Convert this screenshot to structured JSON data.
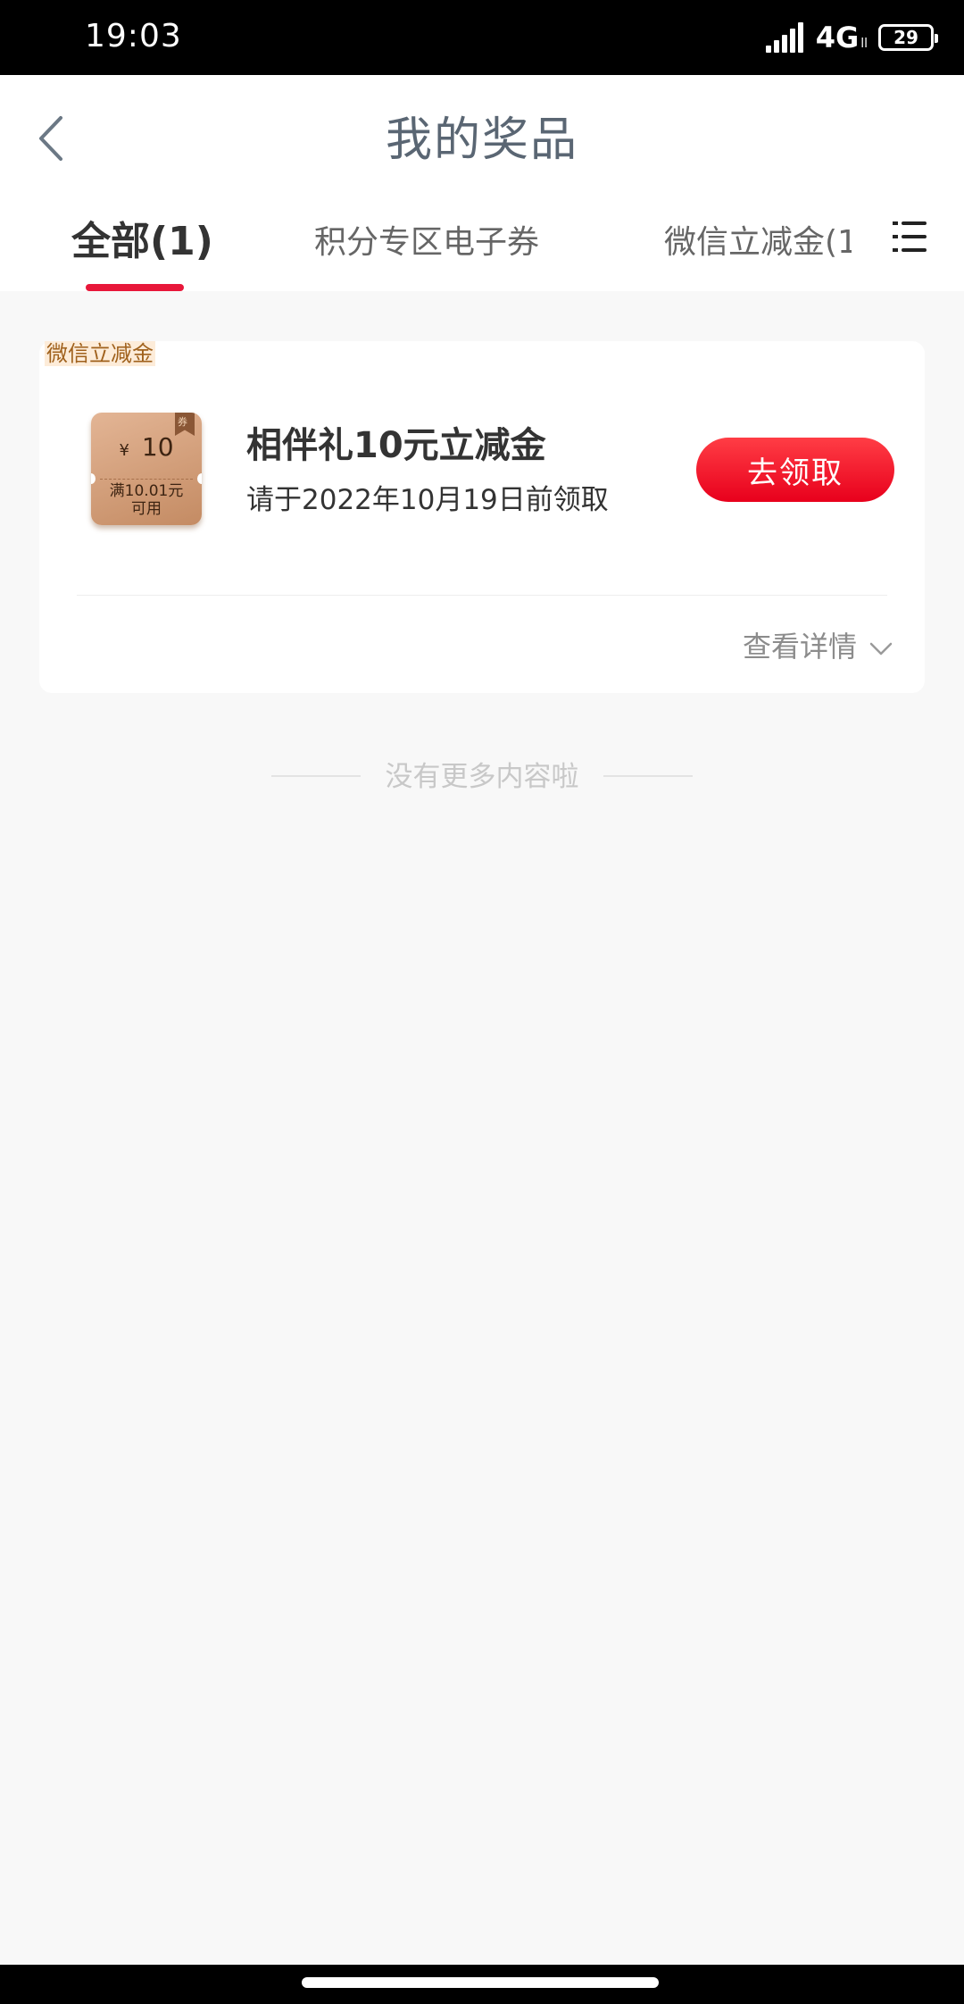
{
  "status_bar": {
    "time": "19:03",
    "network": "4G",
    "network_sub": "ll",
    "battery": "29",
    "icons": [
      "signal-icon",
      "battery-icon"
    ]
  },
  "header": {
    "title": "我的奖品",
    "back_icon": "back-arrow-icon"
  },
  "tabs": {
    "items": [
      {
        "label": "全部(1)",
        "active": true
      },
      {
        "label": "积分专区电子券",
        "active": false
      },
      {
        "label": "微信立减金(1",
        "active": false
      }
    ],
    "menu_icon": "list-menu-icon",
    "accent_color": "#e8173a"
  },
  "prize_card": {
    "tag": "微信立减金",
    "coupon": {
      "currency": "¥",
      "amount": "10",
      "condition_line1": "满10.01元",
      "condition_line2": "可用",
      "ribbon": "券"
    },
    "name": "相伴礼10元立减金",
    "deadline": "请于2022年10月19日前领取",
    "claim_label": "去领取",
    "details_label": "查看详情",
    "button_color": "#ff1a2e"
  },
  "list_footer": {
    "end_text": "没有更多内容啦"
  }
}
